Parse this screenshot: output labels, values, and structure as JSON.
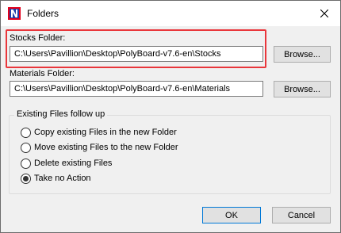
{
  "window": {
    "title": "Folders"
  },
  "stocks": {
    "label": "Stocks Folder:",
    "value": "C:\\Users\\Pavillion\\Desktop\\PolyBoard-v7.6-en\\Stocks",
    "browse_label": "Browse..."
  },
  "materials": {
    "label": "Materials Folder:",
    "value": "C:\\Users\\Pavillion\\Desktop\\PolyBoard-v7.6-en\\Materials",
    "browse_label": "Browse..."
  },
  "existing_files": {
    "legend": "Existing Files follow up",
    "options": [
      {
        "label": "Copy existing Files in the new Folder",
        "selected": false
      },
      {
        "label": "Move existing Files to the new Folder",
        "selected": false
      },
      {
        "label": "Delete existing Files",
        "selected": false
      },
      {
        "label": "Take no Action",
        "selected": true
      }
    ]
  },
  "buttons": {
    "ok": "OK",
    "cancel": "Cancel"
  },
  "colors": {
    "highlight": "#e9363b",
    "default_button_border": "#0078d7",
    "app_icon_red": "#e3001b",
    "app_icon_blue": "#1f3fa8"
  },
  "icons": {
    "app": "polyboard-app-icon",
    "close": "close-icon"
  }
}
